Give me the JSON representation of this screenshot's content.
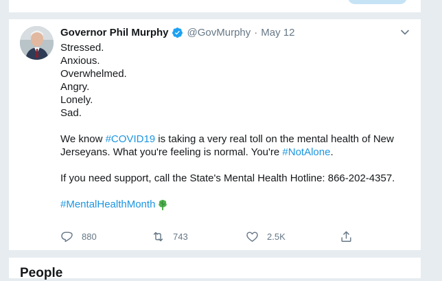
{
  "tweet": {
    "author_name": "Governor Phil Murphy",
    "handle": "@GovMurphy",
    "separator": "·",
    "date": "May 12",
    "lines": {
      "l1": "Stressed.",
      "l2": "Anxious.",
      "l3": "Overwhelmed.",
      "l4": "Angry.",
      "l5": "Lonely.",
      "l6": "Sad.",
      "p2a": "We know ",
      "p2_hashtag": "#COVID19",
      "p2b": " is taking a very real toll on the mental health of New Jerseyans. What you're feeling is normal. You're ",
      "p2_hashtag2": "#NotAlone",
      "p2c": ".",
      "p3": "If you need support, call the State's Mental Health Hotline: 866-202-4357.",
      "p4_hashtag": "#MentalHealthMonth"
    },
    "stats": {
      "replies": "880",
      "retweets": "743",
      "likes": "2.5K"
    }
  },
  "people": {
    "title": "People"
  },
  "colors": {
    "link": "#1b95e0",
    "text": "#14171a",
    "muted": "#657786",
    "verified": "#1da1f2",
    "background": "#e6ecf0"
  },
  "icons": [
    "verified-badge-icon",
    "chevron-down-icon",
    "reply-icon",
    "retweet-icon",
    "like-icon",
    "share-icon",
    "brain-emoji-icon"
  ]
}
